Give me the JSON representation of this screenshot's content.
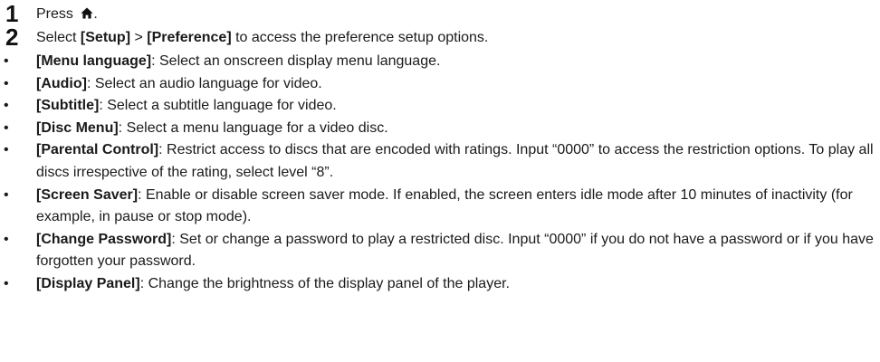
{
  "steps": [
    {
      "number": "1",
      "before": "Press ",
      "icon": "home-icon",
      "after": "."
    },
    {
      "number": "2",
      "prefix": "Select ",
      "bold1": "[Setup]",
      "mid": " > ",
      "bold2": "[Preference]",
      "suffix": " to access the preference setup options."
    }
  ],
  "bullet_glyph": "•",
  "bullets": [
    {
      "term": "[Menu language]",
      "desc": ": Select an onscreen display menu language."
    },
    {
      "term": "[Audio]",
      "desc": ": Select an audio language for video."
    },
    {
      "term": "[Subtitle]",
      "desc": ": Select a subtitle language for video."
    },
    {
      "term": "[Disc Menu]",
      "desc": ": Select a menu language for a video disc."
    },
    {
      "term": "[Parental Control]",
      "desc": ": Restrict access to discs that are encoded with ratings. Input “0000” to access the restriction options. To play all discs irrespective of the rating, select level “8”."
    },
    {
      "term": "[Screen Saver]",
      "desc": ": Enable or disable screen saver mode. If enabled, the screen enters idle mode after 10 minutes of inactivity (for example, in pause or stop mode)."
    },
    {
      "term": "[Change Password]",
      "desc": ": Set or change a password to play a restricted disc. Input “0000” if you do not have a password or if you have forgotten your password."
    },
    {
      "term": "[Display Panel]",
      "desc": ": Change the brightness of the display panel of the player."
    }
  ]
}
